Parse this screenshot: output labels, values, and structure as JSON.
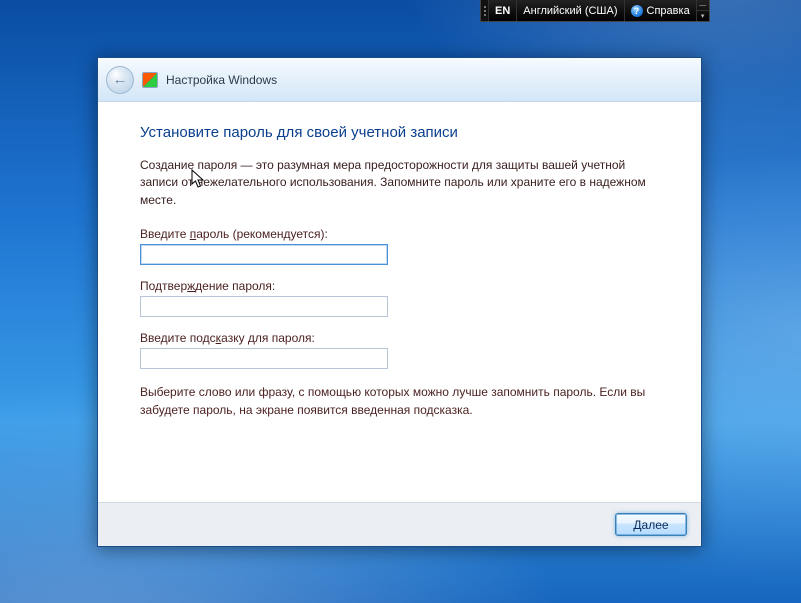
{
  "langbar": {
    "lang_code": "EN",
    "lang_name": "Английский (США)",
    "help_label": "Справка"
  },
  "wizard": {
    "title": "Настройка Windows",
    "heading": "Установите пароль для своей учетной записи",
    "description": "Создание пароля — это разумная мера предосторожности для защиты вашей учетной записи от нежелательного использования. Запомните пароль или храните его в надежном месте.",
    "password_label_pre": "Введите ",
    "password_label_hot": "п",
    "password_label_post": "ароль (рекомендуется):",
    "confirm_label_pre": "Подтвер",
    "confirm_label_hot": "ж",
    "confirm_label_post": "дение пароля:",
    "hint_label_pre": "Введите подс",
    "hint_label_hot": "к",
    "hint_label_post": "азку для пароля:",
    "hint_text": "Выберите слово или фразу, с помощью которых можно лучше запомнить пароль. Если вы забудете пароль, на экране появится введенная подсказка.",
    "next_pre": "",
    "next_hot": "Д",
    "next_post": "алее",
    "password_value": "",
    "confirm_value": "",
    "hint_value": ""
  }
}
